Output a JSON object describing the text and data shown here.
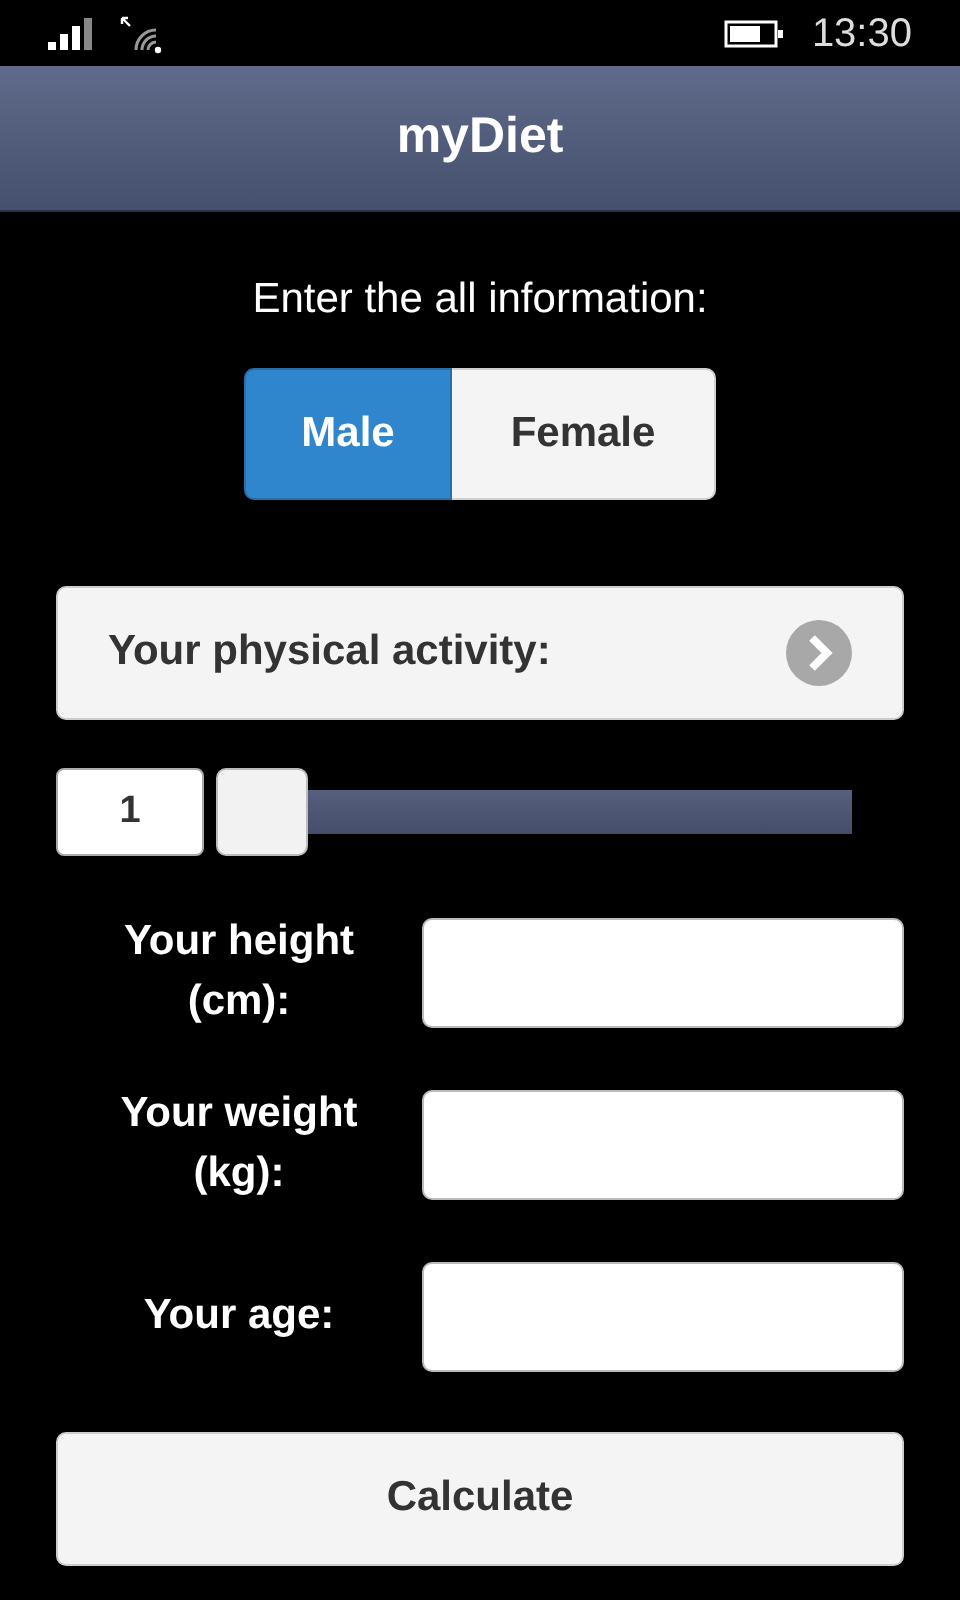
{
  "status_bar": {
    "time": "13:30"
  },
  "header": {
    "title": "myDiet"
  },
  "intro": "Enter the all information:",
  "gender": [
    {
      "label": "Male",
      "selected": true
    },
    {
      "label": "Female",
      "selected": false
    }
  ],
  "activity_button": {
    "label": "Your physical activity:"
  },
  "activity_slider": {
    "value": "1",
    "level": 0
  },
  "fields": [
    {
      "label": "Your height (cm):"
    },
    {
      "label": "Your weight (kg):"
    },
    {
      "label": "Your age:"
    }
  ],
  "calculate_button": {
    "label": "Calculate"
  }
}
